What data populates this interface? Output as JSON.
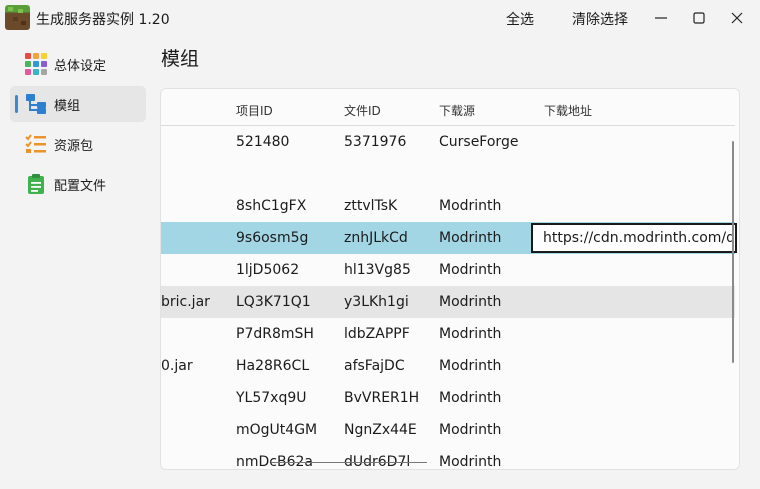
{
  "app": {
    "title": "生成服务器实例 1.20",
    "select_all": "全选",
    "clear_selection": "清除选择"
  },
  "sidebar": {
    "items": [
      {
        "label": "总体设定",
        "icon": "grid-apps-icon",
        "active": false
      },
      {
        "label": "模组",
        "icon": "tree-structure-icon",
        "active": true
      },
      {
        "label": "资源包",
        "icon": "checklist-icon",
        "active": false
      },
      {
        "label": "配置文件",
        "icon": "clipboard-icon",
        "active": false
      }
    ]
  },
  "page": {
    "title": "模组"
  },
  "table": {
    "headers": [
      "项目ID",
      "文件ID",
      "下载源",
      "下载地址"
    ],
    "rows": [
      {
        "name": "",
        "project_id": "521480",
        "file_id": "5371976",
        "source": "CurseForge"
      },
      {
        "name": "",
        "project_id": "",
        "file_id": "",
        "source": ""
      },
      {
        "name": "",
        "project_id": "8shC1gFX",
        "file_id": "zttvlTsK",
        "source": "Modrinth"
      },
      {
        "name": "",
        "project_id": "9s6osm5g",
        "file_id": "znhJLkCd",
        "source": "Modrinth",
        "url": "https://cdn.modrinth.com/d",
        "state": "selected"
      },
      {
        "name": "",
        "project_id": "1ljD5062",
        "file_id": "hl13Vg85",
        "source": "Modrinth"
      },
      {
        "name": "bric.jar",
        "project_id": "LQ3K71Q1",
        "file_id": "y3LKh1gi",
        "source": "Modrinth",
        "state": "hover"
      },
      {
        "name": "",
        "project_id": "P7dR8mSH",
        "file_id": "ldbZAPPF",
        "source": "Modrinth"
      },
      {
        "name": "0.jar",
        "project_id": "Ha28R6CL",
        "file_id": "afsFajDC",
        "source": "Modrinth"
      },
      {
        "name": "",
        "project_id": "YL57xq9U",
        "file_id": "BvVRER1H",
        "source": "Modrinth"
      },
      {
        "name": "",
        "project_id": "mOgUt4GM",
        "file_id": "NgnZx44E",
        "source": "Modrinth"
      },
      {
        "name": "",
        "project_id": "nmDcB62a",
        "file_id": "dUdr6D7l",
        "source": "Modrinth"
      }
    ]
  }
}
